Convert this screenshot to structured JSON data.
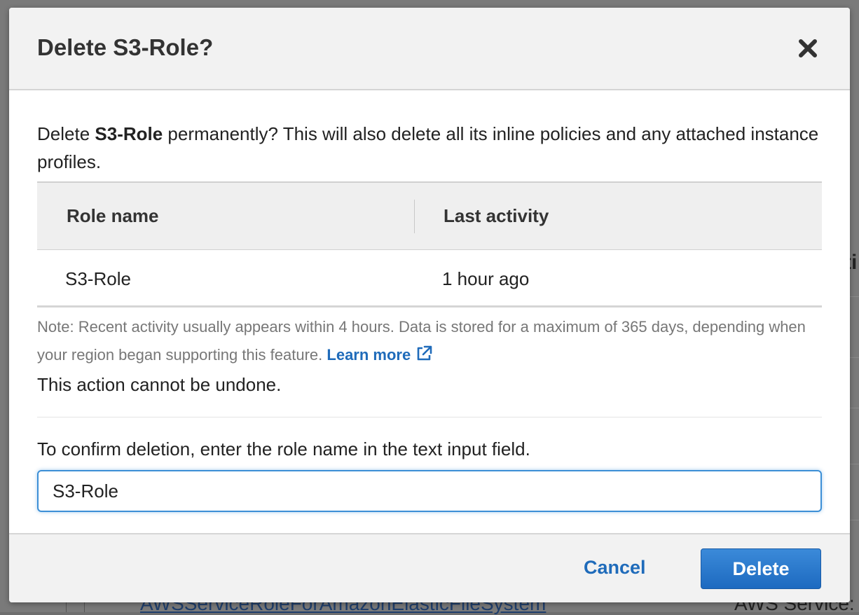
{
  "background": {
    "link_text": "AWSServiceRoleForAmazonElasticFileSystem",
    "service_text": "AWS Service:",
    "edge_text": "ti"
  },
  "modal": {
    "title": "Delete S3-Role?",
    "intro_prefix": "Delete ",
    "intro_role": "S3-Role",
    "intro_suffix": " permanently? This will also delete all its inline policies and any attached instance profiles.",
    "table": {
      "headers": [
        "Role name",
        "Last activity"
      ],
      "rows": [
        {
          "role_name": "S3-Role",
          "last_activity": "1 hour ago"
        }
      ]
    },
    "note_text": "Note: Recent activity usually appears within 4 hours. Data is stored for a maximum of 365 days, depending when your region began supporting this feature. ",
    "learn_more": "Learn more",
    "undone_text": "This action cannot be undone.",
    "confirm_label": "To confirm deletion, enter the role name in the text input field.",
    "confirm_value": "S3-Role",
    "cancel_label": "Cancel",
    "delete_label": "Delete",
    "icons": {
      "close": "close-icon",
      "external_link": "external-link-icon"
    },
    "colors": {
      "link": "#1f6bba",
      "primary_button": "#1d6ac0",
      "input_focus": "#3c8fd6"
    }
  }
}
